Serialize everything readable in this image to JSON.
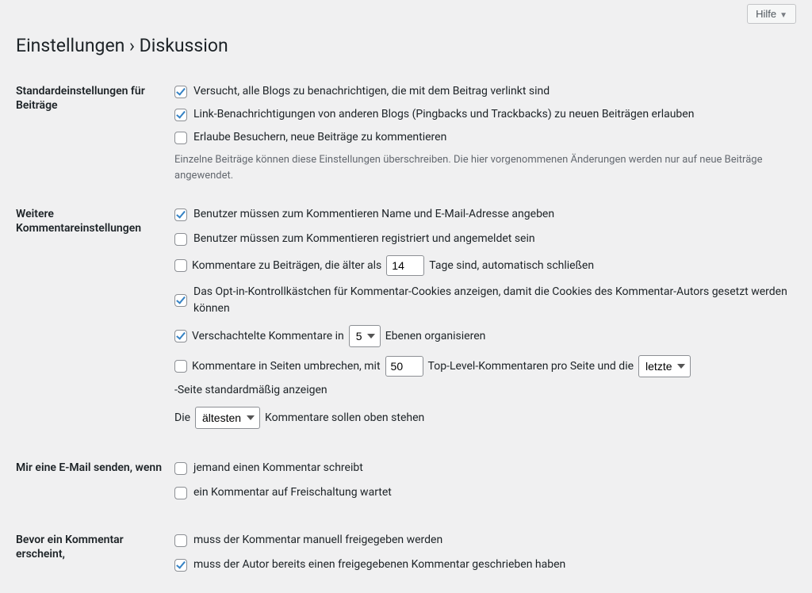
{
  "help_label": "Hilfe",
  "page_title": "Einstellungen › Diskussion",
  "sections": {
    "default_article": {
      "heading": "Standardeinstellungen für Beiträge",
      "opt_pingback": "Versucht, alle Blogs zu benachrichtigen, die mit dem Beitrag verlinkt sind",
      "opt_trackback": "Link-Benachrichtigungen von anderen Blogs (Pingbacks und Trackbacks) zu neuen Beiträgen erlauben",
      "opt_allow_comments": "Erlaube Besuchern, neue Beiträge zu kommentieren",
      "note": "Einzelne Beiträge können diese Einstellungen überschreiben. Die hier vorgenommenen Änderungen werden nur auf neue Beiträge angewendet."
    },
    "other": {
      "heading": "Weitere Kommentareinstellungen",
      "opt_name_email": "Benutzer müssen zum Kommentieren Name und E-Mail-Adresse angeben",
      "opt_registered": "Benutzer müssen zum Kommentieren registriert und angemeldet sein",
      "close_pre": "Kommentare zu Beiträgen, die älter als",
      "close_days": 14,
      "close_post": "Tage sind, automatisch schließen",
      "opt_cookies": "Das Opt-in-Kontrollkästchen für Kommentar-Cookies anzeigen, damit die Cookies des Kommentar-Autors gesetzt werden können",
      "nested_pre": "Verschachtelte Kommentare in",
      "nested_levels": 5,
      "nested_post": "Ebenen organisieren",
      "page_pre": "Kommentare in Seiten umbrechen, mit",
      "page_count": 50,
      "page_mid1": "Top-Level-Kommentaren pro Seite und die",
      "page_default": "letzte",
      "page_post": "-Seite standardmäßig anzeigen",
      "order_pre": "Die",
      "order_value": "ältesten",
      "order_post": "Kommentare sollen oben stehen"
    },
    "email": {
      "heading": "Mir eine E-Mail senden, wenn",
      "opt_someone_comments": "jemand einen Kommentar schreibt",
      "opt_held_moderation": "ein Kommentar auf Freischaltung wartet"
    },
    "before": {
      "heading": "Bevor ein Kommentar erscheint,",
      "opt_manual": "muss der Kommentar manuell freigegeben werden",
      "opt_prev_approved": "muss der Autor bereits einen freigegebenen Kommentar geschrieben haben"
    }
  }
}
